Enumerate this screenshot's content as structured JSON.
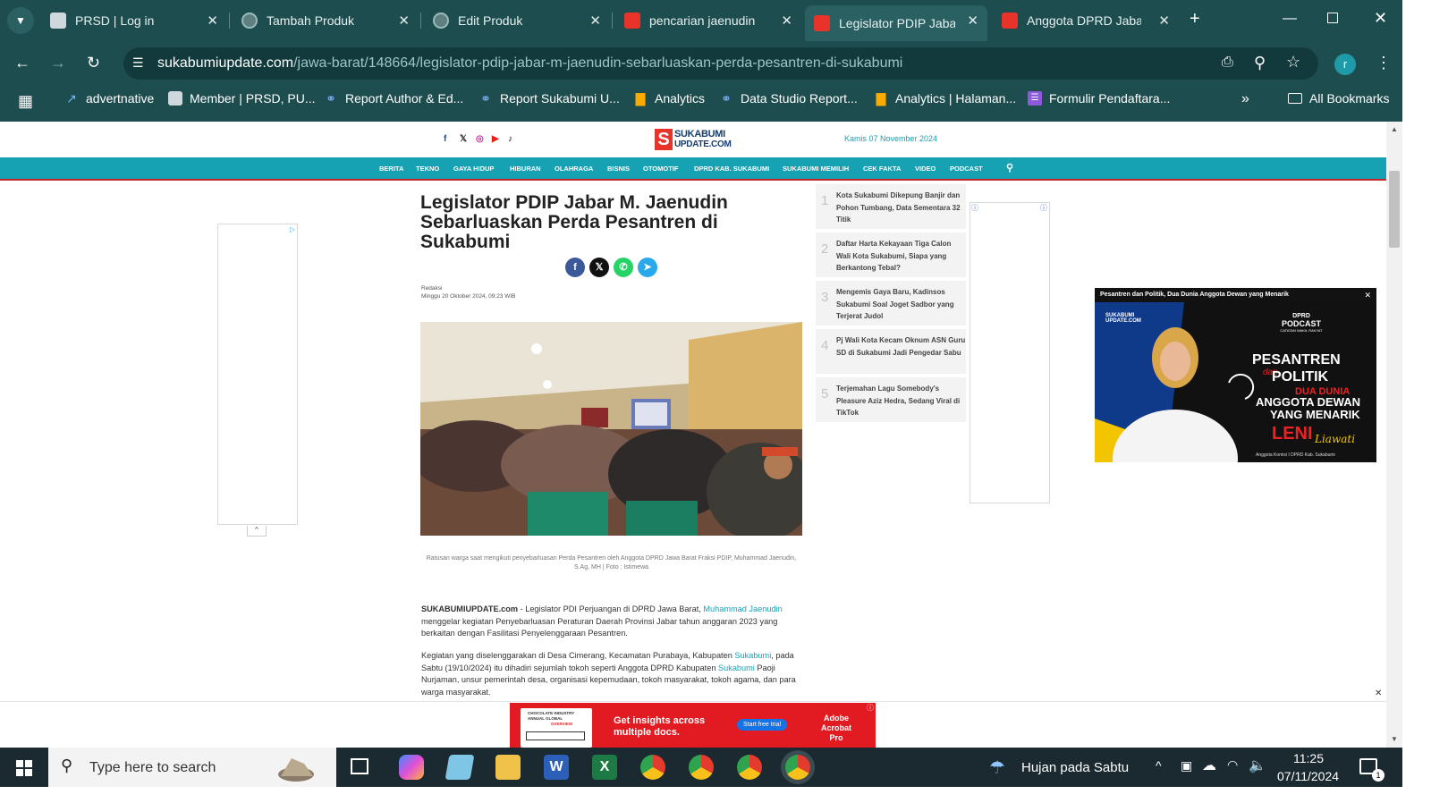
{
  "browser": {
    "tabs": [
      {
        "title": "PRSD | Log in",
        "active": false
      },
      {
        "title": "Tambah Produk",
        "active": false
      },
      {
        "title": "Edit Produk",
        "active": false
      },
      {
        "title": "pencarian jaenudin",
        "active": false
      },
      {
        "title": "Legislator PDIP Jabar M",
        "active": true
      },
      {
        "title": "Anggota DPRD Jabar F",
        "active": false
      }
    ],
    "url_host": "sukabumiupdate.com",
    "url_path": "/jawa-barat/148664/legislator-pdip-jabar-m-jaenudin-sebarluaskan-perda-pesantren-di-sukabumi",
    "profile_initial": "r",
    "bookmarks": [
      "advertnative",
      "Member | PRSD, PU...",
      "Report Author & Ed...",
      "Report Sukabumi U...",
      "Analytics",
      "Data Studio Report...",
      "Analytics | Halaman...",
      "Formulir Pendaftara..."
    ],
    "all_bookmarks": "All Bookmarks"
  },
  "site": {
    "logo_top": "SUKABUMI",
    "logo_bottom": "UPDATE.COM",
    "date": "Kamis 07 November 2024",
    "menu": [
      "BERITA",
      "TEKNO",
      "GAYA HIDUP",
      "HIBURAN",
      "OLAHRAGA",
      "BISNIS",
      "OTOMOTIF",
      "DPRD KAB. SUKABUMI",
      "SUKABUMI MEMILIH",
      "CEK FAKTA",
      "VIDEO",
      "PODCAST"
    ],
    "accent": "#17a2b4",
    "accent_red": "#c7242b"
  },
  "article": {
    "title": "Legislator PDIP Jabar M. Jaenudin Sebarluaskan Perda Pesantren di Sukabumi",
    "author": "Redaksi",
    "date": "Minggu 20 Oktober 2024, 09:23 WIB",
    "caption": "Ratusan warga saat mengikuti penyebarluasan Perda Pesantren oleh Anggota DPRD Jawa Barat Fraksi PDIP, Muhammad Jaenudin, S.Ag, MH | Foto : Istimewa",
    "p1_brand": "SUKABUMIUPDATE.com",
    "p1_a": " - Legislator PDI Perjuangan di DPRD Jawa Barat, ",
    "p1_link": "Muhammad Jaenudin",
    "p1_b": " menggelar kegiatan Penyebarluasan Peraturan Daerah Provinsi Jabar tahun anggaran 2023 yang berkaitan dengan Fasilitasi Penyelenggaraan Pesantren.",
    "p2_a": "Kegiatan yang diselenggarakan di Desa Cimerang, Kecamatan Purabaya, Kabupaten ",
    "p2_link1": "Sukabumi",
    "p2_b": ", pada Sabtu (19/10/2024) itu dihadiri sejumlah tokoh seperti Anggota DPRD Kabupaten ",
    "p2_link2": "Sukabumi",
    "p2_c": " Paoji Nurjaman, unsur pemerintah desa, organisasi kepemudaan, tokoh masyarakat, tokoh agama, dan para warga masyarakat."
  },
  "trending": [
    {
      "n": "1",
      "title": "Kota Sukabumi Dikepung Banjir dan Pohon Tumbang, Data Sementara 32 Titik"
    },
    {
      "n": "2",
      "title": "Daftar Harta Kekayaan Tiga Calon Wali Kota Sukabumi, Siapa yang Berkantong Tebal?"
    },
    {
      "n": "3",
      "title": "Mengemis Gaya Baru, Kadinsos Sukabumi Soal Joget Sadbor yang Terjerat Judol"
    },
    {
      "n": "4",
      "title": "Pj Wali Kota Kecam Oknum ASN Guru SD di Sukabumi Jadi Pengedar Sabu"
    },
    {
      "n": "5",
      "title": "Terjemahan Lagu Somebody's Pleasure Aziz Hedra, Sedang Viral di TikTok"
    }
  ],
  "popup": {
    "heading": "Pesantren dan Politik, Dua Dunia Anggota Dewan yang Menarik",
    "logo": "SUKABUMI UPDATE.COM",
    "badge_top": "DPRD",
    "badge_mid": "PODCAST",
    "badge_bot": "CATATAN WAKIL RAKYAT",
    "l1": "PESANTREN",
    "l2": "dan",
    "l3": "POLITIK",
    "l4": "DUA DUNIA",
    "l5": "ANGGOTA DEWAN",
    "l6": "YANG MENARIK",
    "name1": "LENI",
    "name2": "Liawati",
    "footer": "Anggota Komisi I DPRD Kab. Sukabumi"
  },
  "bottom_ad": {
    "left_top": "CHOCOLATE INDUSTRY",
    "left_mid": "ANNUAL GLOBAL",
    "left_bot": "OVERVIEW",
    "headline": "Get insights across multiple docs.",
    "cta": "Start free trial",
    "brand": "Adobe Acrobat Pro"
  },
  "taskbar": {
    "search_placeholder": "Type here to search",
    "weather": "Hujan pada Sabtu",
    "time": "11:25",
    "date": "07/11/2024",
    "notif_count": "1"
  }
}
